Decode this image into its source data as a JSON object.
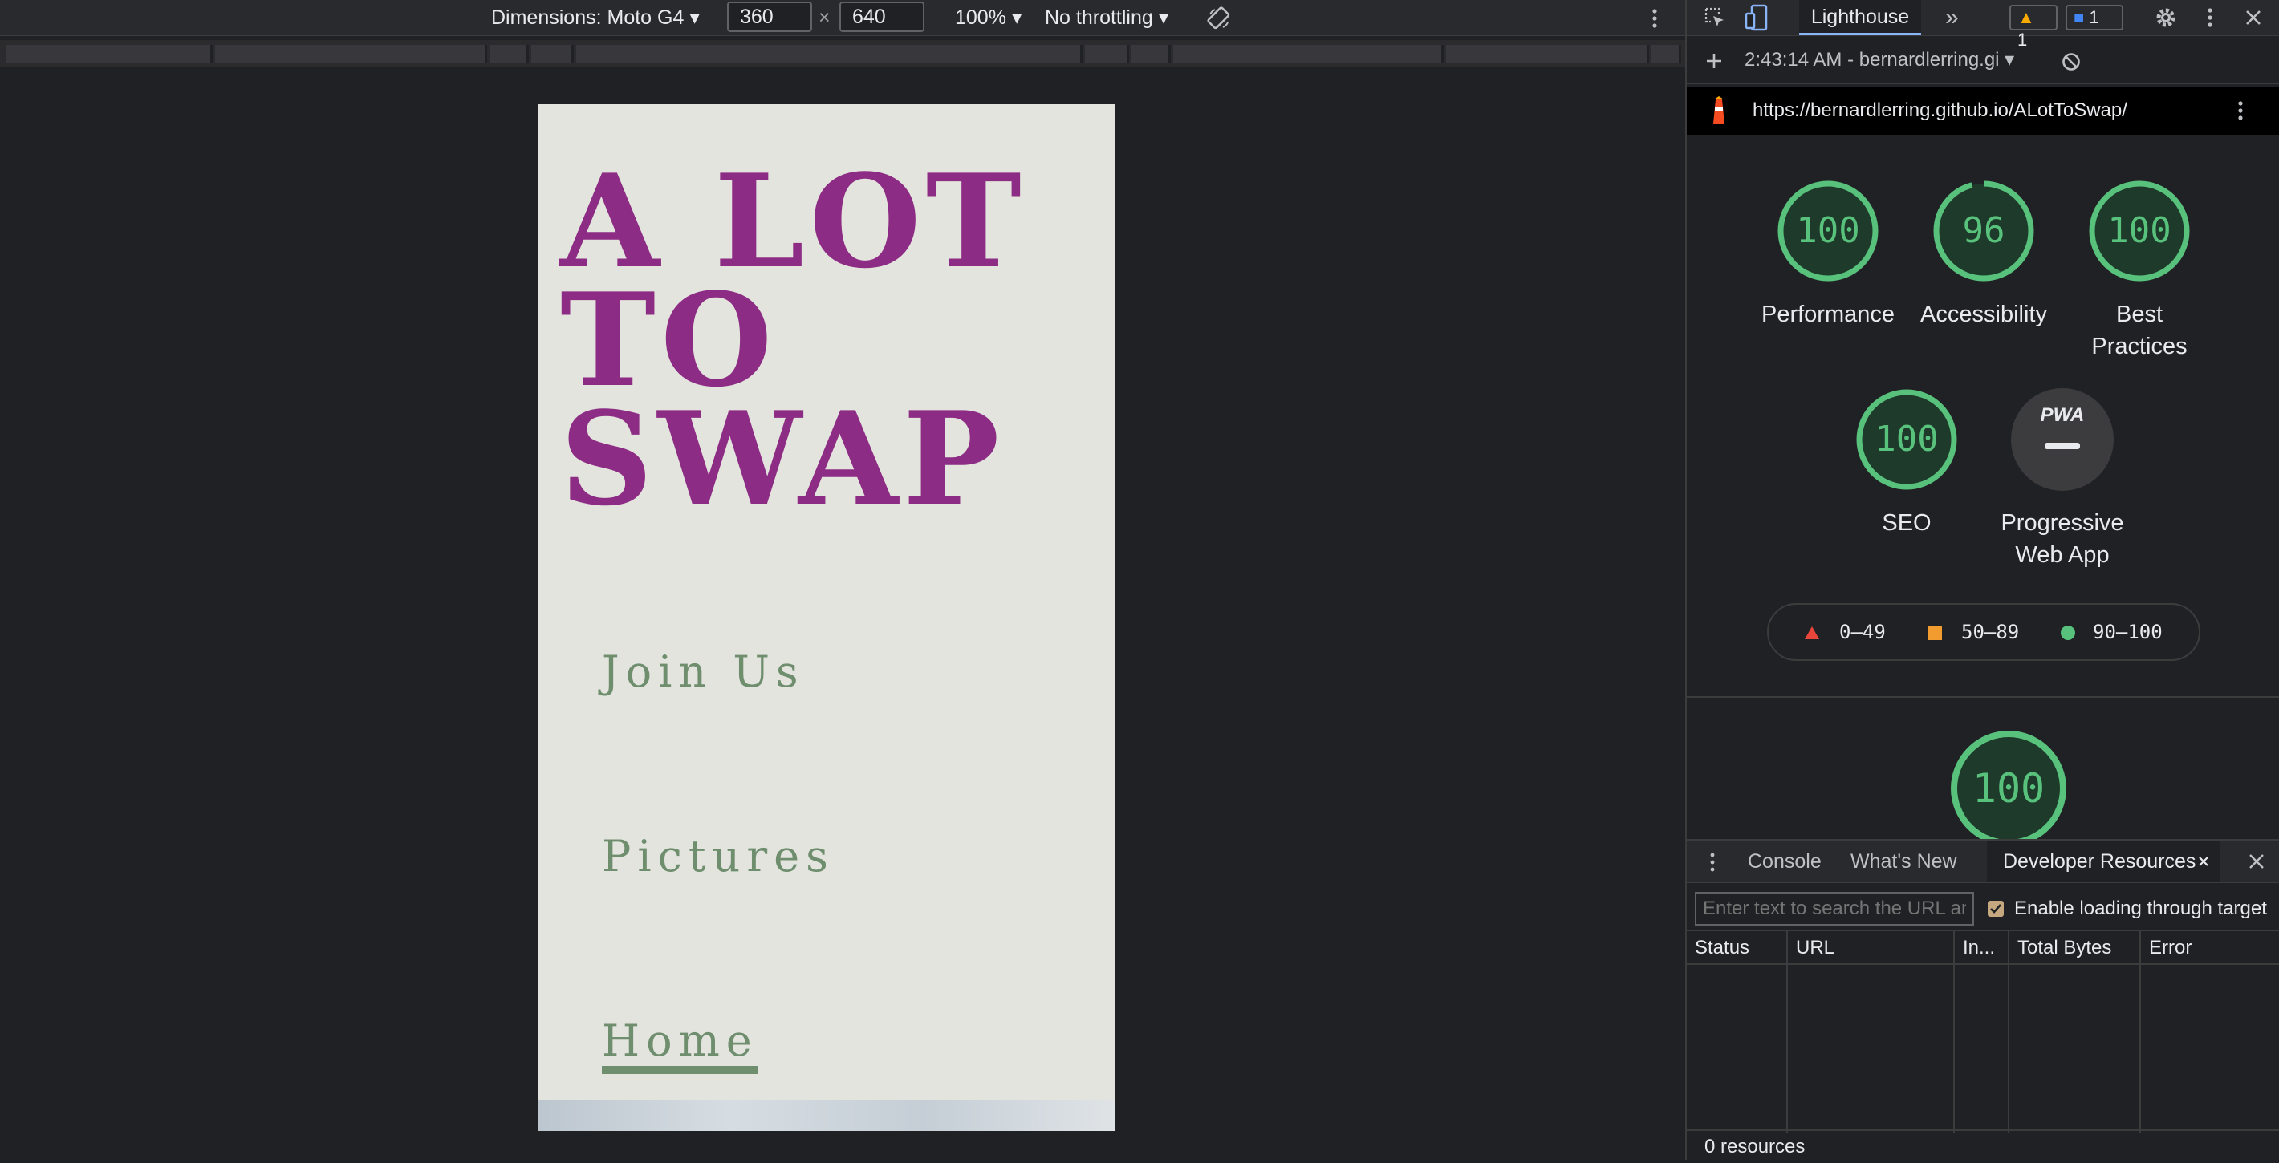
{
  "device_toolbar": {
    "dimensions_label": "Dimensions: Moto G4 ▾",
    "width_value": "360",
    "times": "×",
    "height_value": "640",
    "zoom_label": "100% ▾",
    "throttling_label": "No throttling ▾"
  },
  "site": {
    "title_line1": "A LOT",
    "title_line2": "TO",
    "title_line3": "SWAP",
    "nav": [
      "Join Us",
      "Pictures",
      "Home"
    ],
    "colors": {
      "title": "#8d2c84",
      "nav": "#6e8e6e",
      "background": "#e4e4de"
    }
  },
  "devtools": {
    "active_tab": "Lighthouse",
    "warnings_count": "1",
    "messages_count": "1",
    "report_selector": "2:43:14 AM - bernardlerring.gi ▾",
    "report_url": "https://bernardlerring.github.io/ALotToSwap/",
    "scores": [
      {
        "value": "100",
        "label_line1": "Performance",
        "label_line2": "",
        "fraction": 1.0
      },
      {
        "value": "96",
        "label_line1": "Accessibility",
        "label_line2": "",
        "fraction": 0.96
      },
      {
        "value": "100",
        "label_line1": "Best",
        "label_line2": "Practices",
        "fraction": 1.0
      },
      {
        "value": "100",
        "label_line1": "SEO",
        "label_line2": "",
        "fraction": 1.0
      }
    ],
    "pwa": {
      "badge": "PWA",
      "label_line1": "Progressive",
      "label_line2": "Web App"
    },
    "legend": {
      "fail": "0–49",
      "average": "50–89",
      "pass": "90–100"
    },
    "lower_score": {
      "value": "100",
      "fraction": 1.0
    },
    "colors": {
      "pass": "#58c27d",
      "average": "#f29b2f",
      "fail": "#e8463a"
    },
    "drawer": {
      "tabs": [
        "Console",
        "What's New",
        "Developer Resources"
      ],
      "search_placeholder": "Enter text to search the URL and Error columns",
      "enable_loading_label": "Enable loading through target",
      "columns": [
        "Status",
        "URL",
        "In...",
        "Total Bytes",
        "Error"
      ],
      "footer": "0 resources"
    }
  }
}
